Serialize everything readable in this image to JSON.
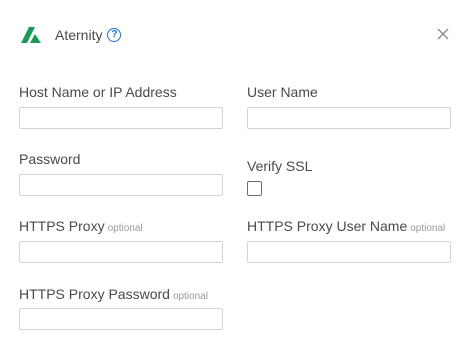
{
  "header": {
    "title": "Aternity",
    "help_glyph": "?",
    "logo_icon": "aternity-logo-icon",
    "close_icon": "close-icon",
    "brand_color": "#1a9a57",
    "accent_color": "#1a73e8"
  },
  "form": {
    "host": {
      "label": "Host Name or IP Address",
      "value": "",
      "placeholder": ""
    },
    "user": {
      "label": "User Name",
      "value": "",
      "placeholder": ""
    },
    "password": {
      "label": "Password",
      "value": "",
      "placeholder": ""
    },
    "verify_ssl": {
      "label": "Verify SSL",
      "checked": false
    },
    "proxy": {
      "label": "HTTPS Proxy",
      "hint": "optional",
      "value": "",
      "placeholder": ""
    },
    "proxy_user": {
      "label": "HTTPS Proxy User Name",
      "hint": "optional",
      "value": "",
      "placeholder": ""
    },
    "proxy_password": {
      "label": "HTTPS Proxy Password",
      "hint": "optional",
      "value": "",
      "placeholder": ""
    }
  }
}
